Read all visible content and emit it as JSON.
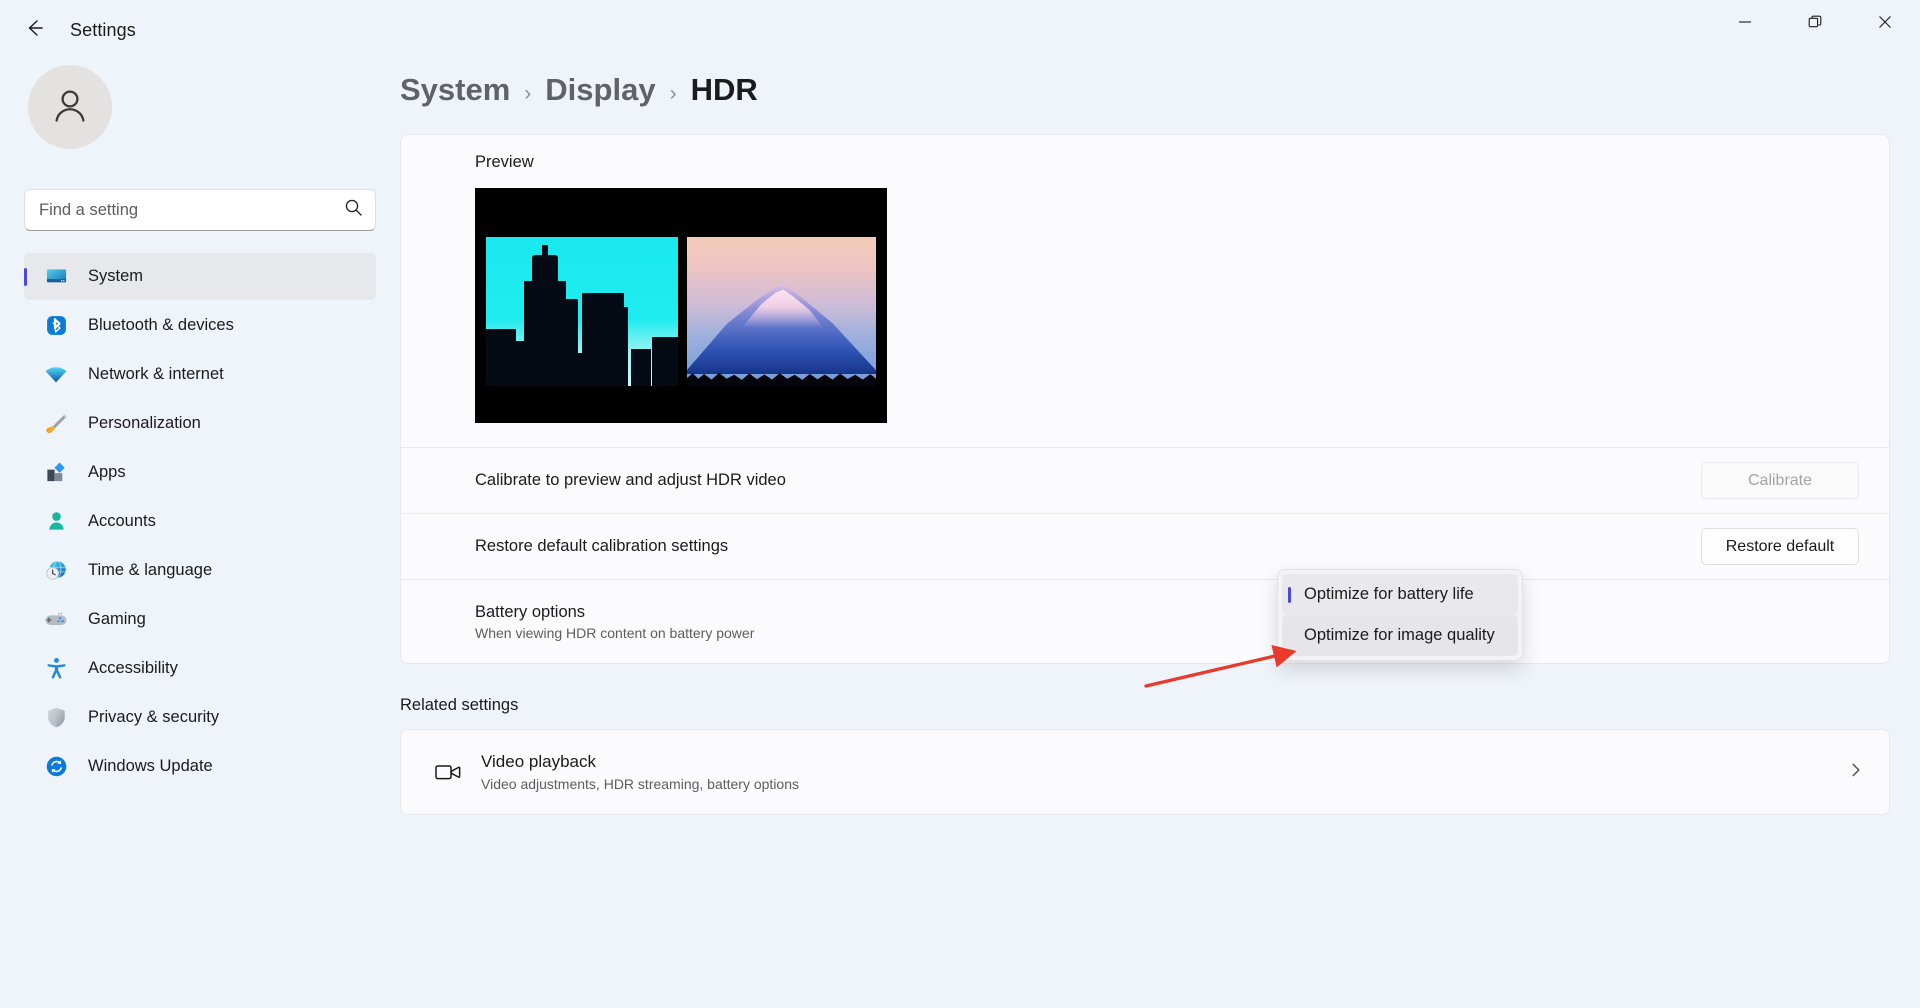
{
  "window": {
    "title": "Settings",
    "back_icon": "back-arrow-icon",
    "minimize_icon": "minimize-icon",
    "maximize_icon": "maximize-restore-icon",
    "close_icon": "close-icon"
  },
  "sidebar": {
    "avatar_icon": "user-avatar-icon",
    "search": {
      "placeholder": "Find a setting",
      "value": "",
      "icon": "search-icon"
    },
    "items": [
      {
        "label": "System",
        "icon": "monitor-icon",
        "active": true
      },
      {
        "label": "Bluetooth & devices",
        "icon": "bluetooth-icon",
        "active": false
      },
      {
        "label": "Network & internet",
        "icon": "wifi-icon",
        "active": false
      },
      {
        "label": "Personalization",
        "icon": "paintbrush-icon",
        "active": false
      },
      {
        "label": "Apps",
        "icon": "apps-blocks-icon",
        "active": false
      },
      {
        "label": "Accounts",
        "icon": "person-icon",
        "active": false
      },
      {
        "label": "Time & language",
        "icon": "clock-globe-icon",
        "active": false
      },
      {
        "label": "Gaming",
        "icon": "gamepad-icon",
        "active": false
      },
      {
        "label": "Accessibility",
        "icon": "accessibility-person-icon",
        "active": false
      },
      {
        "label": "Privacy & security",
        "icon": "shield-icon",
        "active": false
      },
      {
        "label": "Windows Update",
        "icon": "refresh-circle-icon",
        "active": false
      }
    ]
  },
  "breadcrumb": {
    "items": [
      "System",
      "Display",
      "HDR"
    ],
    "separator": "›",
    "current_index": 2
  },
  "main": {
    "preview": {
      "label": "Preview",
      "image_alt": "hdr-preview-sdr-vs-hdr-split-image"
    },
    "rows": [
      {
        "title": "Calibrate to preview and adjust HDR video",
        "sub": "",
        "button": "Calibrate",
        "disabled": true
      },
      {
        "title": "Restore default calibration settings",
        "sub": "",
        "button": "Restore default",
        "disabled": false
      }
    ],
    "battery": {
      "title": "Battery options",
      "sub": "When viewing HDR content on battery power",
      "selected_value": "Optimize for battery life",
      "options": [
        {
          "label": "Optimize for battery life",
          "selected": true,
          "hovered": false
        },
        {
          "label": "Optimize for image quality",
          "selected": false,
          "hovered": true
        }
      ]
    },
    "related": {
      "heading": "Related settings",
      "items": [
        {
          "title": "Video playback",
          "sub": "Video adjustments, HDR streaming, battery options",
          "icon": "video-camera-icon",
          "chevron": "chevron-right-icon"
        }
      ]
    }
  },
  "annotation": {
    "arrow_color": "#e8392b",
    "target": "Optimize for image quality"
  },
  "colors": {
    "accent": "#4a4ad8",
    "window_bg": "#eff3fa",
    "card_bg": "#fbfbfd",
    "text": "#1b1b1b",
    "muted_text": "#5d5d5d"
  }
}
